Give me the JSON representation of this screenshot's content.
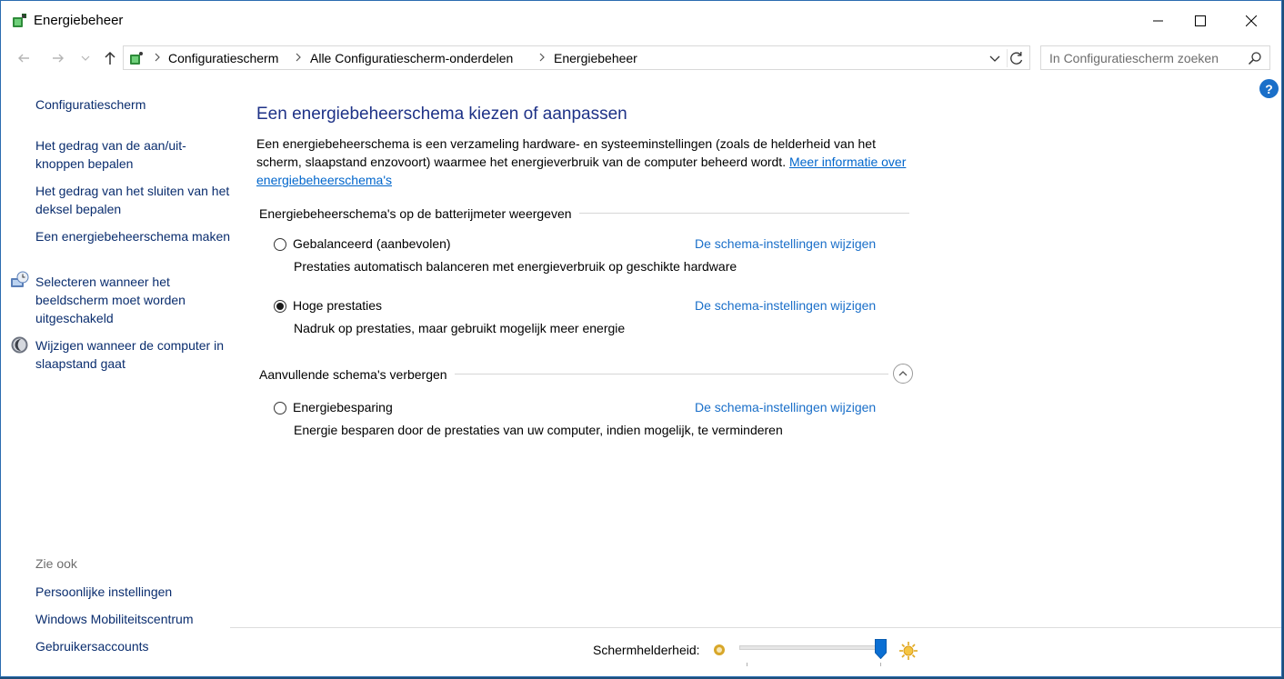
{
  "window": {
    "title": "Energiebeheer",
    "controls": {
      "minimize": "minimize",
      "maximize": "maximize",
      "close": "close"
    }
  },
  "nav": {
    "breadcrumbs": [
      "Configuratiescherm",
      "Alle Configuratiescherm-onderdelen",
      "Energiebeheer"
    ],
    "search_placeholder": "In Configuratiescherm zoeken"
  },
  "sidebar": {
    "home_link": "Configuratiescherm",
    "tasks": [
      {
        "label": "Het gedrag van de aan/uit-knoppen bepalen",
        "icon": null
      },
      {
        "label": "Het gedrag van het sluiten van het deksel bepalen",
        "icon": null
      },
      {
        "label": "Een energiebeheerschema maken",
        "icon": null
      },
      {
        "label": "Selecteren wanneer het beeldscherm moet worden uitgeschakeld",
        "icon": "monitor-clock-icon"
      },
      {
        "label": "Wijzigen wanneer de computer in slaapstand gaat",
        "icon": "moon-icon"
      }
    ],
    "see_also_heading": "Zie ook",
    "see_also": [
      "Persoonlijke instellingen",
      "Windows Mobiliteitscentrum",
      "Gebruikersaccounts"
    ]
  },
  "main": {
    "title": "Een energiebeheerschema kiezen of aanpassen",
    "intro_text": "Een energiebeheerschema is een verzameling hardware- en systeeminstellingen (zoals de helderheid van het scherm, slaapstand enzovoort) waarmee het energieverbruik van de computer beheerd wordt. ",
    "intro_link": "Meer informatie over energiebeheerschema's",
    "battery_group_heading": "Energiebeheerschema's op de batterijmeter weergeven",
    "plans": [
      {
        "name": "Gebalanceerd (aanbevolen)",
        "description": "Prestaties automatisch balanceren met energieverbruik op geschikte hardware",
        "link": "De schema-instellingen wijzigen",
        "selected": false
      },
      {
        "name": "Hoge prestaties",
        "description": "Nadruk op prestaties, maar gebruikt mogelijk meer energie",
        "link": "De schema-instellingen wijzigen",
        "selected": true
      }
    ],
    "extra_group_heading": "Aanvullende schema's verbergen",
    "extra_plans": [
      {
        "name": "Energiebesparing",
        "description": "Energie besparen door de prestaties van uw computer, indien mogelijk, te verminderen",
        "link": "De schema-instellingen wijzigen",
        "selected": false
      }
    ]
  },
  "brightness": {
    "label": "Schermhelderheid:",
    "level_percent": 100
  },
  "colors": {
    "title_blue": "#1e3287",
    "link_blue": "#1a6fc9",
    "nav_link": "#0a2d6e",
    "desktop": "#1e4f7a"
  }
}
